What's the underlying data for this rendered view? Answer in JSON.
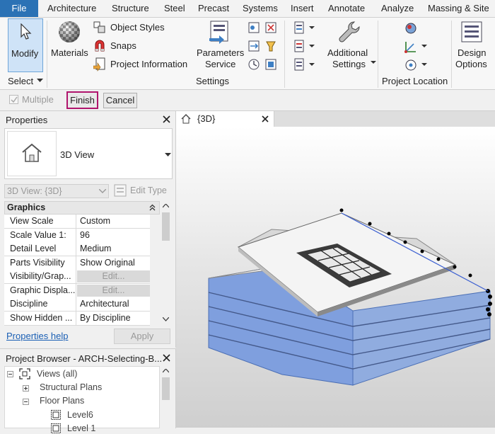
{
  "ribbon": {
    "tabs": [
      "File",
      "Architecture",
      "Structure",
      "Steel",
      "Precast",
      "Systems",
      "Insert",
      "Annotate",
      "Analyze",
      "Massing & Site"
    ],
    "modify_label": "Modify",
    "select_label": "Select",
    "materials_label": "Materials",
    "object_styles_label": "Object  Styles",
    "snaps_label": "Snaps",
    "project_information_label": "Project  Information",
    "parameters_service_line1": "Parameters",
    "parameters_service_line2": "Service",
    "settings_panel_label": "Settings",
    "additional_settings_line1": "Additional",
    "additional_settings_line2": "Settings",
    "project_location_label": "Project Location",
    "design_options_line1": "Design",
    "design_options_line2": "Options"
  },
  "options_bar": {
    "multiple_label": "Multiple",
    "finish_label": "Finish",
    "cancel_label": "Cancel"
  },
  "properties": {
    "title": "Properties",
    "type_name": "3D View",
    "instance_selector": "3D View: {3D}",
    "edit_type_label": "Edit Type",
    "group_label": "Graphics",
    "rows": [
      {
        "name": "View Scale",
        "value": "Custom"
      },
      {
        "name": "Scale Value    1:",
        "value": "96"
      },
      {
        "name": "Detail Level",
        "value": "Medium"
      },
      {
        "name": "Parts Visibility",
        "value": "Show Original"
      },
      {
        "name": "Visibility/Grap...",
        "value": "Edit..."
      },
      {
        "name": "Graphic Displa...",
        "value": "Edit..."
      },
      {
        "name": "Discipline",
        "value": "Architectural"
      },
      {
        "name": "Show Hidden ...",
        "value": "By Discipline"
      }
    ],
    "help_link": "Properties help",
    "apply_label": "Apply"
  },
  "project_browser": {
    "title": "Project Browser - ARCH-Selecting-B...",
    "items": [
      "Views (all)",
      "Structural Plans",
      "Floor Plans",
      "Level6",
      "Level 1"
    ]
  },
  "view": {
    "tab_label": "{3D}"
  },
  "colors": {
    "file_tab": "#2b72b5",
    "selection_blue": "#7f9fde",
    "finish_highlight": "#b0156d",
    "link": "#1a5fb4"
  }
}
